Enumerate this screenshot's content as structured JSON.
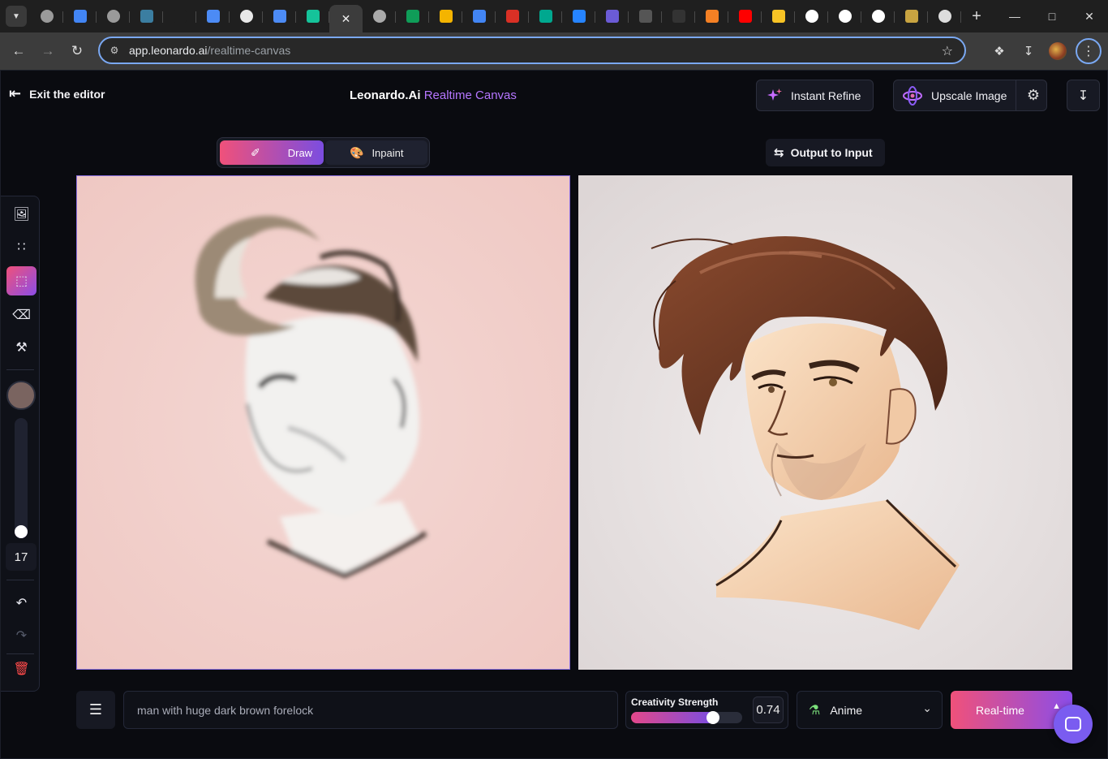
{
  "browser": {
    "tabs": [
      {
        "fav": "chatgpt",
        "color": "#9a9a9a"
      },
      {
        "fav": "search",
        "color": "#4285f4"
      },
      {
        "fav": "openai",
        "color": "#9a9a9a"
      },
      {
        "fav": "drive",
        "color": "#3b7ea1"
      },
      {
        "fav": "blank",
        "color": "#1f1f1f"
      },
      {
        "fav": "extension",
        "color": "#4c8bf5"
      },
      {
        "fav": "openai",
        "color": "#e8e8e8"
      },
      {
        "fav": "translate",
        "color": "#4c8bf5"
      },
      {
        "fav": "grammarly",
        "color": "#15c39a"
      },
      {
        "fav": "active",
        "color": "#3c3c3c"
      },
      {
        "fav": "globe",
        "color": "#aaaaaa"
      },
      {
        "fav": "sheets",
        "color": "#0f9d58"
      },
      {
        "fav": "slides",
        "color": "#f4b400"
      },
      {
        "fav": "docs",
        "color": "#4285f4"
      },
      {
        "fav": "loader",
        "color": "#d93025"
      },
      {
        "fav": "diamond",
        "color": "#00a88f"
      },
      {
        "fav": "jira",
        "color": "#2684ff"
      },
      {
        "fav": "bing",
        "color": "#6b5bd6"
      },
      {
        "fav": "medium",
        "color": "#555555"
      },
      {
        "fav": "github",
        "color": "#333333"
      },
      {
        "fav": "stackoverflow",
        "color": "#f48024"
      },
      {
        "fav": "youtube",
        "color": "#ff0000"
      },
      {
        "fav": "emoji",
        "color": "#f7c325"
      },
      {
        "fav": "google",
        "color": "#ffffff"
      },
      {
        "fav": "google",
        "color": "#ffffff"
      },
      {
        "fav": "google",
        "color": "#ffffff"
      },
      {
        "fav": "crown",
        "color": "#c9a441"
      },
      {
        "fav": "chrome",
        "color": "#dddddd"
      }
    ],
    "url_host": "app.leonardo.ai",
    "url_path": "/realtime-canvas"
  },
  "header": {
    "exit_label": "Exit the editor",
    "title_main": "Leonardo.Ai",
    "title_accent": "Realtime Canvas",
    "refine_label": "Instant Refine",
    "upscale_label": "Upscale Image"
  },
  "modes": {
    "draw_label": "Draw",
    "inpaint_label": "Inpaint",
    "active": "Draw"
  },
  "output_to_input_label": "Output to Input",
  "rail": {
    "tools": [
      "image-upload-icon",
      "grid-select-icon",
      "select-icon",
      "eraser-icon",
      "paint-bucket-icon"
    ],
    "active_tool": "select-icon",
    "brush_color": "#7a6460",
    "brush_size": "17",
    "brush_size_fraction": 0.0
  },
  "prompt": {
    "value": "man with huge dark brown forelock"
  },
  "creativity": {
    "label": "Creativity Strength",
    "value": "0.74",
    "fraction": 0.74
  },
  "style": {
    "selected": "Anime"
  },
  "realtime_label": "Real-time"
}
